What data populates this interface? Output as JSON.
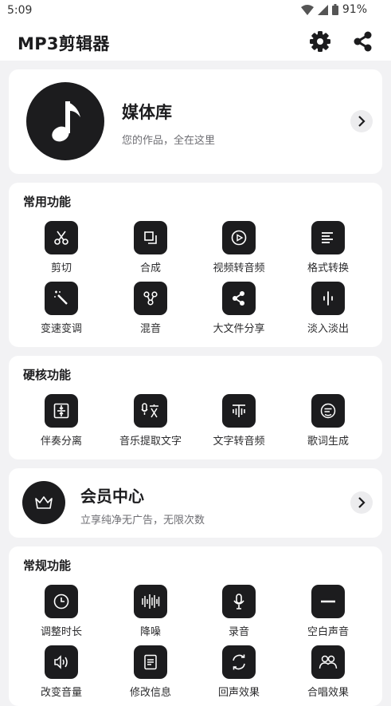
{
  "status_bar": {
    "time": "5:09",
    "battery": "91%"
  },
  "header": {
    "title": "MP3剪辑器",
    "settings_icon": "gear-icon",
    "share_icon": "share-icon"
  },
  "media_library": {
    "title": "媒体库",
    "subtitle": "您的作品，全在这里",
    "icon": "music-note-icon"
  },
  "common_functions": {
    "title": "常用功能",
    "items": [
      {
        "label": "剪切",
        "icon": "scissors-icon"
      },
      {
        "label": "合成",
        "icon": "merge-icon"
      },
      {
        "label": "视频转音频",
        "icon": "video-play-icon"
      },
      {
        "label": "格式转换",
        "icon": "format-lines-icon"
      },
      {
        "label": "变速变调",
        "icon": "magic-wand-icon"
      },
      {
        "label": "混音",
        "icon": "mix-nodes-icon"
      },
      {
        "label": "大文件分享",
        "icon": "share-icon"
      },
      {
        "label": "淡入淡出",
        "icon": "fade-icon"
      }
    ]
  },
  "core_functions": {
    "title": "硬核功能",
    "items": [
      {
        "label": "伴奏分离",
        "icon": "separate-icon"
      },
      {
        "label": "音乐提取文字",
        "icon": "translate-icon"
      },
      {
        "label": "文字转音频",
        "icon": "text-audio-icon"
      },
      {
        "label": "歌词生成",
        "icon": "lyrics-icon"
      }
    ]
  },
  "vip": {
    "title": "会员中心",
    "subtitle": "立享纯净无广告，无限次数",
    "icon": "crown-icon"
  },
  "regular_functions": {
    "title": "常规功能",
    "items": [
      {
        "label": "调整时长",
        "icon": "clock-icon"
      },
      {
        "label": "降噪",
        "icon": "waveform-icon"
      },
      {
        "label": "录音",
        "icon": "microphone-icon"
      },
      {
        "label": "空白声音",
        "icon": "minus-icon"
      },
      {
        "label": "改变音量",
        "icon": "volume-icon"
      },
      {
        "label": "修改信息",
        "icon": "document-icon"
      },
      {
        "label": "回声效果",
        "icon": "echo-icon"
      },
      {
        "label": "合唱效果",
        "icon": "chorus-icon"
      }
    ]
  }
}
